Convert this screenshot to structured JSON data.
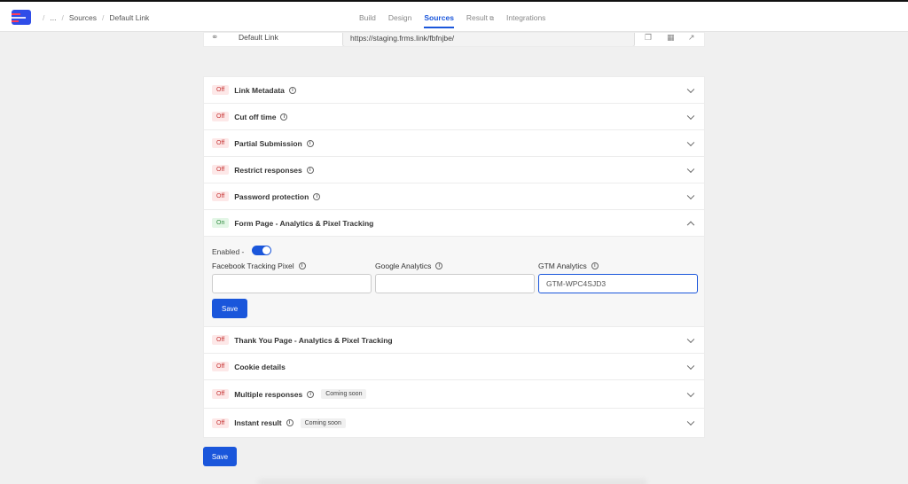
{
  "breadcrumbs": [
    "...",
    "Sources",
    "Default Link"
  ],
  "nav": [
    {
      "label": "Build",
      "active": false
    },
    {
      "label": "Design",
      "active": false
    },
    {
      "label": "Sources",
      "active": true
    },
    {
      "label": "Result",
      "active": false
    },
    {
      "label": "Integrations",
      "active": false
    }
  ],
  "link": {
    "label": "Default Link",
    "url": "https://staging.frms.link/fbfnjbe/"
  },
  "settings": [
    {
      "status": "Off",
      "title": "Link Metadata"
    },
    {
      "status": "Off",
      "title": "Cut off time"
    },
    {
      "status": "Off",
      "title": "Partial Submission"
    },
    {
      "status": "Off",
      "title": "Restrict responses"
    },
    {
      "status": "Off",
      "title": "Password protection"
    },
    {
      "status": "On",
      "title": "Form Page - Analytics & Pixel Tracking"
    },
    {
      "status": "Off",
      "title": "Thank You Page - Analytics & Pixel Tracking"
    },
    {
      "status": "Off",
      "title": "Cookie details"
    },
    {
      "status": "Off",
      "title": "Multiple responses",
      "badge": "Coming soon"
    },
    {
      "status": "Off",
      "title": "Instant result",
      "badge": "Coming soon"
    }
  ],
  "tracking": {
    "enabled_label": "Enabled -",
    "enabled": true,
    "fields": [
      {
        "label": "Facebook Tracking Pixel",
        "value": ""
      },
      {
        "label": "Google Analytics",
        "value": ""
      },
      {
        "label": "GTM Analytics",
        "value": "GTM-WPC4SJD3"
      }
    ],
    "save_label": "Save"
  },
  "save_label": "Save",
  "colors": {
    "accent": "#1a56db",
    "off_badge": "#fde8e8",
    "on_badge": "#e3f6e6"
  }
}
